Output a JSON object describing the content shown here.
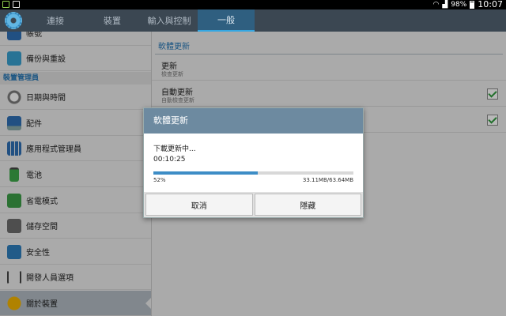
{
  "status_bar": {
    "battery": "98%",
    "time": "10:07"
  },
  "tabs": [
    {
      "label": "連接"
    },
    {
      "label": "裝置"
    },
    {
      "label": "輸入與控制"
    },
    {
      "label": "一般"
    }
  ],
  "sidebar": {
    "items": [
      {
        "label": "帳號"
      },
      {
        "label": "備份與重設"
      },
      {
        "header": "裝置管理員"
      },
      {
        "label": "日期與時間"
      },
      {
        "label": "配件"
      },
      {
        "label": "應用程式管理員"
      },
      {
        "label": "電池"
      },
      {
        "label": "省電模式"
      },
      {
        "label": "儲存空間"
      },
      {
        "label": "安全性"
      },
      {
        "label": "開發人員選項"
      },
      {
        "label": "關於裝置"
      }
    ]
  },
  "main": {
    "section": "軟體更新",
    "rows": [
      {
        "title": "更新",
        "subtitle": "檢查更新"
      },
      {
        "title": "自動更新",
        "subtitle": "自動檢查更新",
        "checked": true
      },
      {
        "checked": true
      }
    ]
  },
  "dialog": {
    "title": "軟體更新",
    "message": "下載更新中...",
    "elapsed": "00:10:25",
    "progress_percent": "52%",
    "progress_fraction": 0.52,
    "size": "33.11MB/63.64MB",
    "cancel_label": "取消",
    "hide_label": "隱藏"
  },
  "colors": {
    "accent": "#34a7e2",
    "section": "#2778b6",
    "dialog_title": "#6d8aa0"
  }
}
